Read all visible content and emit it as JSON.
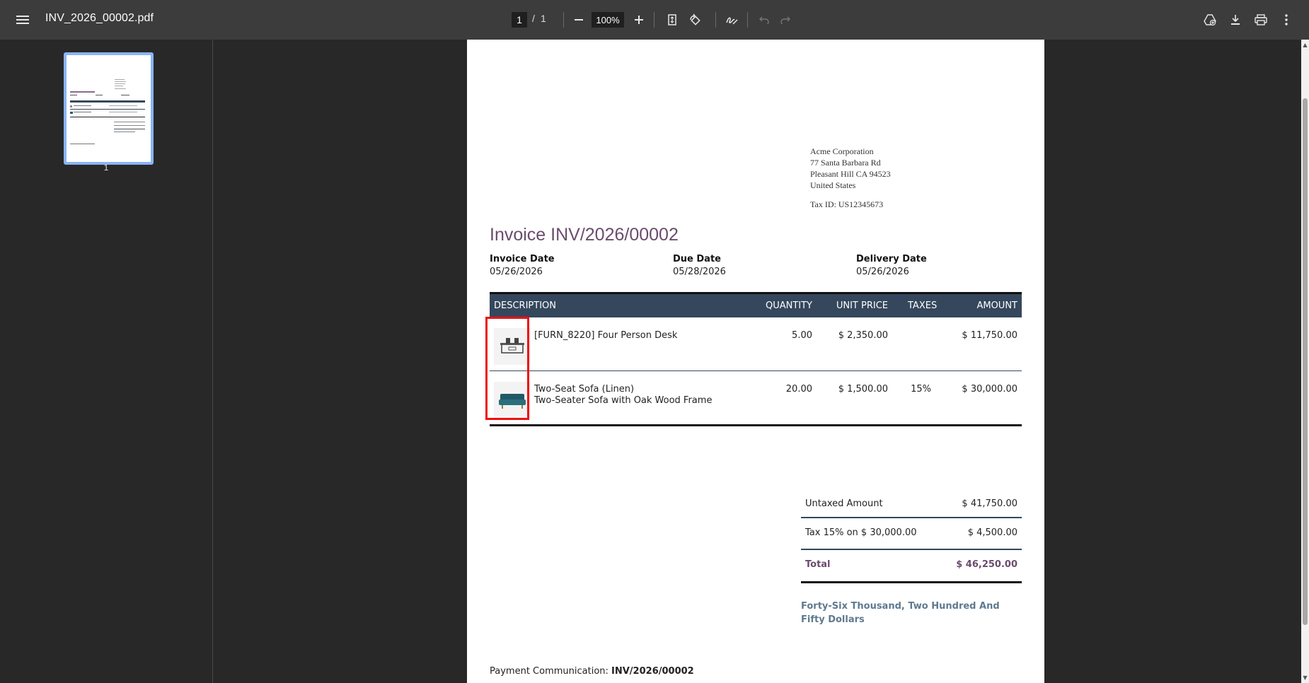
{
  "toolbar": {
    "file_name": "INV_2026_00002.pdf",
    "current_page": "1",
    "page_separator": "/",
    "total_pages": "1",
    "zoom": "100%"
  },
  "sidebar": {
    "thumbnails": [
      {
        "page_label": "1"
      }
    ]
  },
  "invoice": {
    "company": {
      "name": "Acme Corporation",
      "street": "77 Santa Barbara Rd",
      "city_line": "Pleasant Hill CA 94523",
      "country": "United States",
      "tax_id": "Tax ID: US12345673"
    },
    "title": "Invoice INV/2026/00002",
    "dates": {
      "invoice_date_label": "Invoice Date",
      "invoice_date": "05/26/2026",
      "due_date_label": "Due Date",
      "due_date": "05/28/2026",
      "delivery_date_label": "Delivery Date",
      "delivery_date": "05/26/2026"
    },
    "columns": {
      "description": "DESCRIPTION",
      "quantity": "QUANTITY",
      "unit_price": "UNIT PRICE",
      "taxes": "TAXES",
      "amount": "AMOUNT"
    },
    "lines": [
      {
        "description": "[FURN_8220] Four Person Desk",
        "description2": "",
        "quantity": "5.00",
        "unit_price": "$ 2,350.00",
        "taxes": "",
        "amount": "$ 11,750.00",
        "image_icon": "desk-product-image"
      },
      {
        "description": "Two-Seat Sofa (Linen)",
        "description2": "Two-Seater Sofa with Oak Wood Frame",
        "quantity": "20.00",
        "unit_price": "$ 1,500.00",
        "taxes": "15%",
        "amount": "$ 30,000.00",
        "image_icon": "sofa-product-image"
      }
    ],
    "totals": {
      "untaxed_label": "Untaxed Amount",
      "untaxed_value": "$ 41,750.00",
      "tax_label": "Tax 15% on $ 30,000.00",
      "tax_value": "$ 4,500.00",
      "total_label": "Total",
      "total_value": "$ 46,250.00"
    },
    "amount_in_words": "Forty-Six Thousand, Two Hundred And Fifty Dollars",
    "payment_label": "Payment Communication: ",
    "payment_ref": "INV/2026/00002"
  },
  "colors": {
    "toolbar_bg": "#3c3c3c",
    "viewer_bg": "#282828",
    "table_header": "#35475d",
    "title_purple": "#6b4c6e",
    "total_purple": "#6b4c6e",
    "highlight_red": "#ee1111",
    "thumb_border": "#8ab4f8"
  }
}
